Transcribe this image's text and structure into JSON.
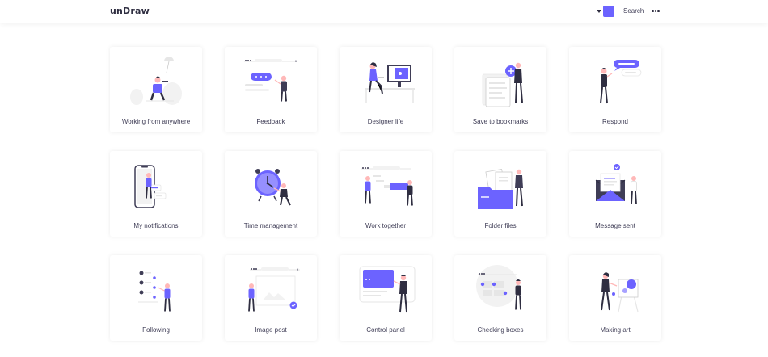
{
  "header": {
    "brand": "unDraw",
    "search_label": "Search",
    "accent_color": "#6c63ff",
    "color_picker_icon": "chevron-down-icon",
    "more_icon": "more-horizontal-icon"
  },
  "colors": {
    "accent": "#6c63ff",
    "dark": "#2f2e41",
    "light": "#f2f2f2",
    "skin": "#ffb8b8"
  },
  "illustrations": [
    {
      "label": "Working from anywhere",
      "icon": "working-from-anywhere-illustration"
    },
    {
      "label": "Feedback",
      "icon": "feedback-illustration"
    },
    {
      "label": "Designer life",
      "icon": "designer-life-illustration"
    },
    {
      "label": "Save to bookmarks",
      "icon": "save-to-bookmarks-illustration"
    },
    {
      "label": "Respond",
      "icon": "respond-illustration"
    },
    {
      "label": "My notifications",
      "icon": "my-notifications-illustration"
    },
    {
      "label": "Time management",
      "icon": "time-management-illustration"
    },
    {
      "label": "Work together",
      "icon": "work-together-illustration"
    },
    {
      "label": "Folder files",
      "icon": "folder-files-illustration"
    },
    {
      "label": "Message sent",
      "icon": "message-sent-illustration"
    },
    {
      "label": "Following",
      "icon": "following-illustration"
    },
    {
      "label": "Image post",
      "icon": "image-post-illustration"
    },
    {
      "label": "Control panel",
      "icon": "control-panel-illustration"
    },
    {
      "label": "Checking boxes",
      "icon": "checking-boxes-illustration"
    },
    {
      "label": "Making art",
      "icon": "making-art-illustration"
    }
  ]
}
